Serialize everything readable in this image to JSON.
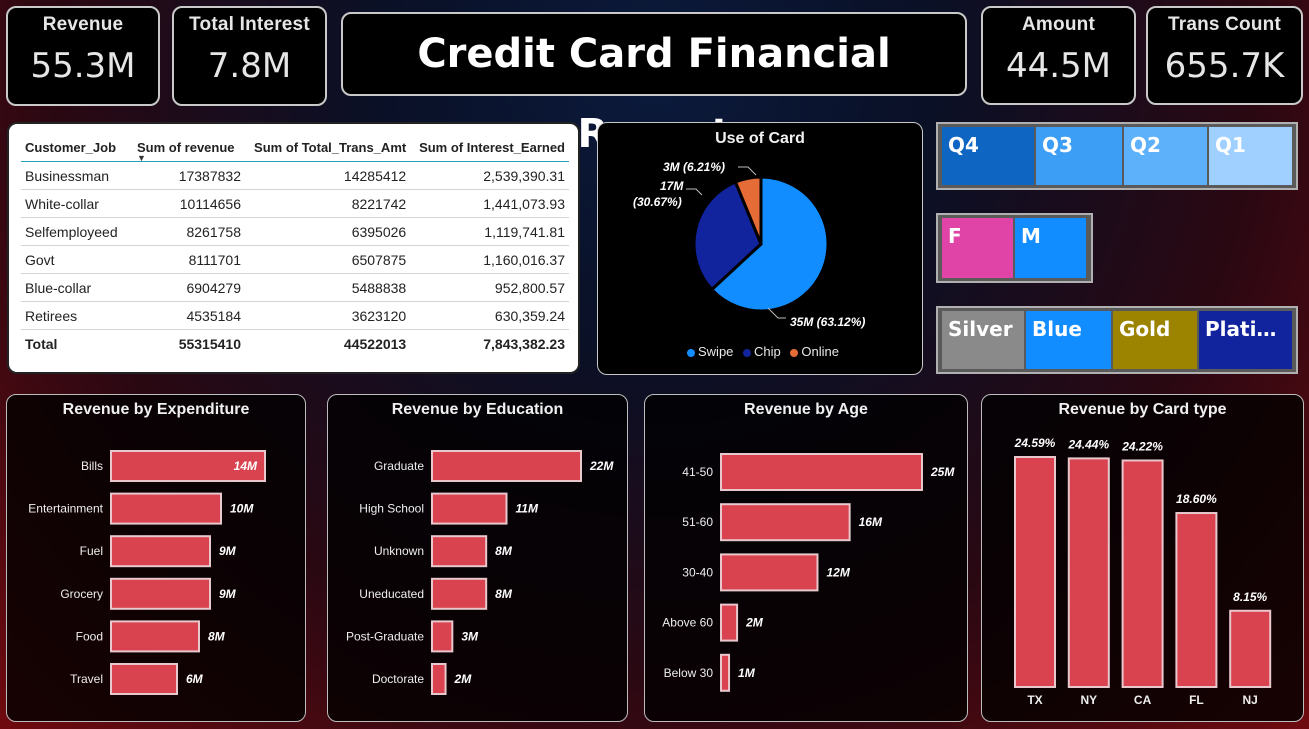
{
  "kpis": {
    "revenue": {
      "label": "Revenue",
      "value": "55.3M"
    },
    "total_interest": {
      "label": "Total Interest",
      "value": "7.8M"
    },
    "amount": {
      "label": "Amount",
      "value": "44.5M"
    },
    "trans_count": {
      "label": "Trans Count",
      "value": "655.7K"
    }
  },
  "title": "Credit Card Financial Report",
  "table": {
    "headers": [
      "Customer_Job",
      "Sum of revenue",
      "Sum of Total_Trans_Amt",
      "Sum of Interest_Earned"
    ],
    "rows": [
      [
        "Businessman",
        "17387832",
        "14285412",
        "2,539,390.31"
      ],
      [
        "White-collar",
        "10114656",
        "8221742",
        "1,441,073.93"
      ],
      [
        "Selfemployeed",
        "8261758",
        "6395026",
        "1,119,741.81"
      ],
      [
        "Govt",
        "8111701",
        "6507875",
        "1,160,016.37"
      ],
      [
        "Blue-collar",
        "6904279",
        "5488838",
        "952,800.57"
      ],
      [
        "Retirees",
        "4535184",
        "3623120",
        "630,359.24"
      ]
    ],
    "total": [
      "Total",
      "55315410",
      "44522013",
      "7,843,382.23"
    ]
  },
  "pie": {
    "title": "Use of Card",
    "slices": [
      {
        "name": "Swipe",
        "pct": 63.12,
        "label": "35M (63.12%)",
        "color": "#118DFF"
      },
      {
        "name": "Chip",
        "pct": 30.67,
        "label_line1": "17M",
        "label_line2": "(30.67%)",
        "color": "#12239E"
      },
      {
        "name": "Online",
        "pct": 6.21,
        "label": "3M (6.21%)",
        "color": "#E66C37"
      }
    ]
  },
  "slicers": {
    "quarter": [
      {
        "label": "Q4",
        "color": "#0f66c2"
      },
      {
        "label": "Q3",
        "color": "#3c9ef5"
      },
      {
        "label": "Q2",
        "color": "#5db0fa"
      },
      {
        "label": "Q1",
        "color": "#9fd0ff"
      }
    ],
    "gender": [
      {
        "label": "F",
        "color": "#e044a7"
      },
      {
        "label": "M",
        "color": "#118DFF"
      }
    ],
    "card": [
      {
        "label": "Silver",
        "color": "#8a8a8a"
      },
      {
        "label": "Blue",
        "color": "#118DFF"
      },
      {
        "label": "Gold",
        "color": "#9c8400"
      },
      {
        "label": "Plati…",
        "color": "#12239E"
      }
    ]
  },
  "chart_data": [
    {
      "type": "bar",
      "orientation": "horizontal",
      "title": "Revenue by Expenditure",
      "categories": [
        "Bills",
        "Entertainment",
        "Fuel",
        "Grocery",
        "Food",
        "Travel"
      ],
      "values": [
        14,
        10,
        9,
        9,
        8,
        6
      ],
      "labels": [
        "14M",
        "10M",
        "9M",
        "9M",
        "8M",
        "6M"
      ],
      "unit": "M",
      "bar_color": "#d9434f"
    },
    {
      "type": "bar",
      "orientation": "horizontal",
      "title": "Revenue by Education",
      "categories": [
        "Graduate",
        "High School",
        "Unknown",
        "Uneducated",
        "Post-Graduate",
        "Doctorate"
      ],
      "values": [
        22,
        11,
        8,
        8,
        3,
        2
      ],
      "labels": [
        "22M",
        "11M",
        "8M",
        "8M",
        "3M",
        "2M"
      ],
      "unit": "M",
      "bar_color": "#d9434f"
    },
    {
      "type": "bar",
      "orientation": "horizontal",
      "title": "Revenue by Age",
      "categories": [
        "41-50",
        "51-60",
        "30-40",
        "Above 60",
        "Below 30"
      ],
      "values": [
        25,
        16,
        12,
        2,
        1
      ],
      "labels": [
        "25M",
        "16M",
        "12M",
        "2M",
        "1M"
      ],
      "unit": "M",
      "bar_color": "#d9434f"
    },
    {
      "type": "bar",
      "orientation": "vertical",
      "title": "Revenue by Card type",
      "categories": [
        "TX",
        "NY",
        "CA",
        "FL",
        "NJ"
      ],
      "values": [
        24.59,
        24.44,
        24.22,
        18.6,
        8.15
      ],
      "labels": [
        "24.59%",
        "24.44%",
        "24.22%",
        "18.60%",
        "8.15%"
      ],
      "unit": "%",
      "bar_color": "#d9434f"
    }
  ]
}
